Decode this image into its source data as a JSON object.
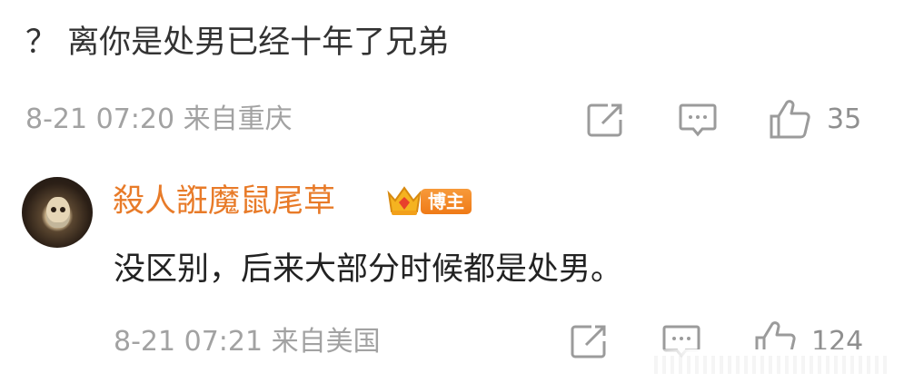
{
  "comment1": {
    "text": "？ 离你是处男已经十年了兄弟",
    "meta": "8-21 07:20 来自重庆",
    "like_count": "35"
  },
  "comment2": {
    "username": "殺人誑魔鼠尾草",
    "badge": "博主",
    "text": "没区别，后来大部分时候都是处男。",
    "meta": "8-21 07:21 来自美国",
    "like_count": "124"
  },
  "colors": {
    "username": "#e87b29",
    "badge": "#f08020",
    "meta": "#a2a2a2",
    "icon": "#9b9b9b"
  },
  "icons": [
    "share-icon",
    "comment-icon",
    "thumbs-up-icon",
    "crown-icon"
  ]
}
